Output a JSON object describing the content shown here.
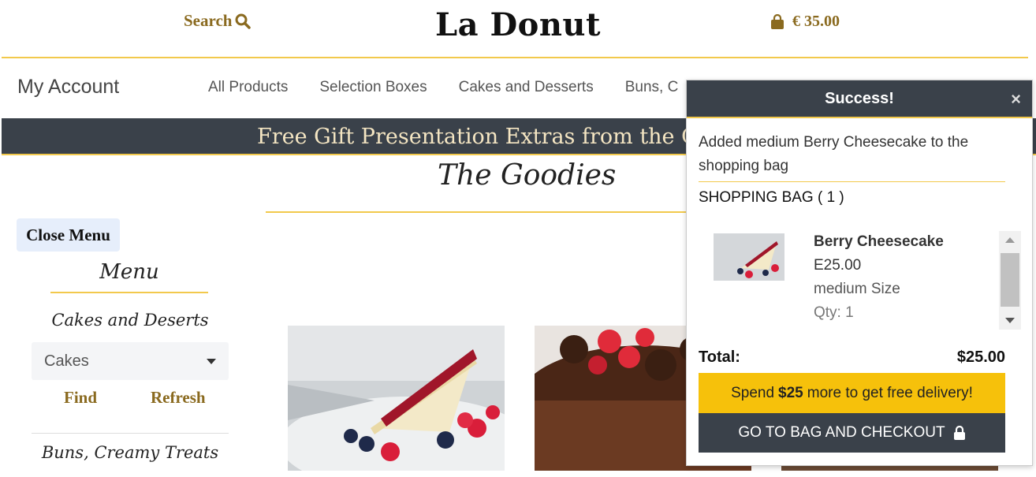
{
  "header": {
    "search_label": "Search",
    "brand": "La Donut",
    "cart_total": "€ 35.00"
  },
  "nav": {
    "my_account": "My Account",
    "items": [
      "All Products",
      "Selection Boxes",
      "Cakes and Desserts",
      "Buns, C"
    ]
  },
  "banner": {
    "text": "Free Gift Presentation Extras from the C"
  },
  "main": {
    "title": "The Goodies"
  },
  "sidebar": {
    "close_menu": "Close Menu",
    "menu_title": "Menu",
    "category_1": "Cakes and Deserts",
    "select_value": "Cakes",
    "find": "Find",
    "refresh": "Refresh",
    "category_2": "Buns, Creamy Treats"
  },
  "toast": {
    "title": "Success!",
    "close": "×",
    "message": "Added medium Berry Cheesecake to the shopping bag",
    "bag_title": "SHOPPING BAG ( 1 )",
    "item": {
      "name": "Berry Cheesecake",
      "price": "E25.00",
      "size": "medium Size",
      "qty": "Qty: 1"
    },
    "total_label": "Total:",
    "total_value": "$25.00",
    "spend_prefix": "Spend",
    "spend_amount": "$25",
    "spend_suffix": "more to get free delivery!",
    "checkout": "GO TO BAG AND CHECKOUT"
  },
  "colors": {
    "accent_gold": "#8a6a1f",
    "accent_yellow": "#f2c94c",
    "dark_slate": "#3a414a",
    "spend_bg": "#f6c10b"
  },
  "icons": [
    "search-icon",
    "shopping-bag-icon",
    "close-icon",
    "lock-icon",
    "chevron-down-icon"
  ]
}
